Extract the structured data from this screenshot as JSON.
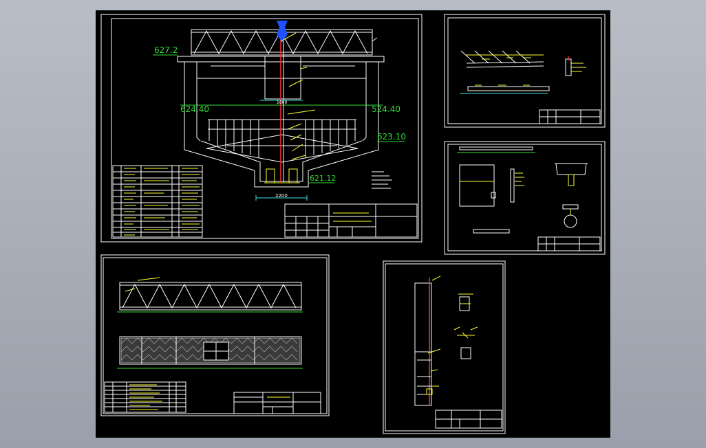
{
  "drawing": {
    "background": "#000000",
    "elevations": {
      "top_left": "627.2",
      "water_left": "624.40",
      "water_right": "524.40",
      "cone_right": "623.10",
      "bottom_right": "621.12"
    },
    "dimensions": {
      "bottom_width": "2200",
      "central_width": "1600"
    }
  },
  "colors": {
    "line_white": "#ffffff",
    "line_yellow": "#ffff33",
    "line_green": "#35e035",
    "line_red": "#ff3030",
    "label_green": "#2fdc2f"
  }
}
